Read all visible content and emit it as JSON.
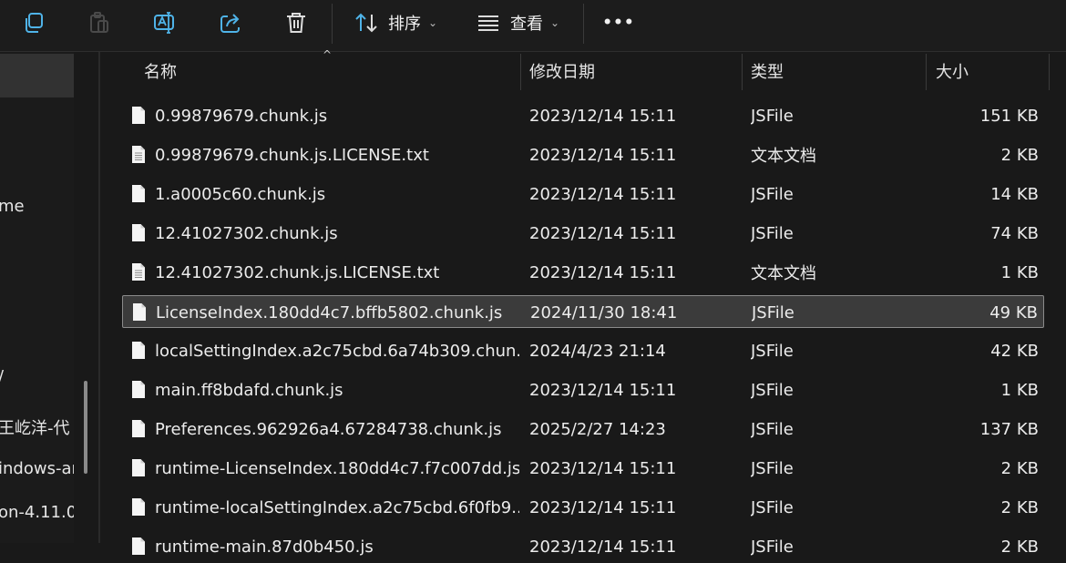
{
  "toolbar": {
    "icons": [
      "copy-icon",
      "paste-icon",
      "rename-icon",
      "share-icon",
      "delete-icon",
      "sort-icon",
      "view-icon",
      "more-icon"
    ],
    "sort_label": "排序",
    "view_label": "查看",
    "more_label": "•••"
  },
  "sidebar": {
    "items": [
      {
        "label": "me"
      },
      {
        "label": "/"
      },
      {
        "label": "王屹洋-代"
      },
      {
        "label": "indows-ar"
      },
      {
        "label": "on-4.11.0."
      }
    ]
  },
  "columns": {
    "name": "名称",
    "date": "修改日期",
    "type": "类型",
    "size": "大小",
    "sort_indicator": "^"
  },
  "files": [
    {
      "name": "0.99879679.chunk.js",
      "date": "2023/12/14 15:11",
      "type": "JSFile",
      "size": "151 KB",
      "icon": "js-file-icon"
    },
    {
      "name": "0.99879679.chunk.js.LICENSE.txt",
      "date": "2023/12/14 15:11",
      "type": "文本文档",
      "size": "2 KB",
      "icon": "text-file-icon"
    },
    {
      "name": "1.a0005c60.chunk.js",
      "date": "2023/12/14 15:11",
      "type": "JSFile",
      "size": "14 KB",
      "icon": "js-file-icon"
    },
    {
      "name": "12.41027302.chunk.js",
      "date": "2023/12/14 15:11",
      "type": "JSFile",
      "size": "74 KB",
      "icon": "js-file-icon"
    },
    {
      "name": "12.41027302.chunk.js.LICENSE.txt",
      "date": "2023/12/14 15:11",
      "type": "文本文档",
      "size": "1 KB",
      "icon": "text-file-icon"
    },
    {
      "name": "LicenseIndex.180dd4c7.bffb5802.chunk.js",
      "date": "2024/11/30 18:41",
      "type": "JSFile",
      "size": "49 KB",
      "icon": "js-file-icon",
      "selected": true
    },
    {
      "name": "localSettingIndex.a2c75cbd.6a74b309.chun...",
      "date": "2024/4/23 21:14",
      "type": "JSFile",
      "size": "42 KB",
      "icon": "js-file-icon"
    },
    {
      "name": "main.ff8bdafd.chunk.js",
      "date": "2023/12/14 15:11",
      "type": "JSFile",
      "size": "1 KB",
      "icon": "js-file-icon"
    },
    {
      "name": "Preferences.962926a4.67284738.chunk.js",
      "date": "2025/2/27 14:23",
      "type": "JSFile",
      "size": "137 KB",
      "icon": "js-file-icon"
    },
    {
      "name": "runtime-LicenseIndex.180dd4c7.f7c007dd.js",
      "date": "2023/12/14 15:11",
      "type": "JSFile",
      "size": "2 KB",
      "icon": "js-file-icon"
    },
    {
      "name": "runtime-localSettingIndex.a2c75cbd.6f0fb9...",
      "date": "2023/12/14 15:11",
      "type": "JSFile",
      "size": "2 KB",
      "icon": "js-file-icon"
    },
    {
      "name": "runtime-main.87d0b450.js",
      "date": "2023/12/14 15:11",
      "type": "JSFile",
      "size": "2 KB",
      "icon": "js-file-icon"
    }
  ]
}
